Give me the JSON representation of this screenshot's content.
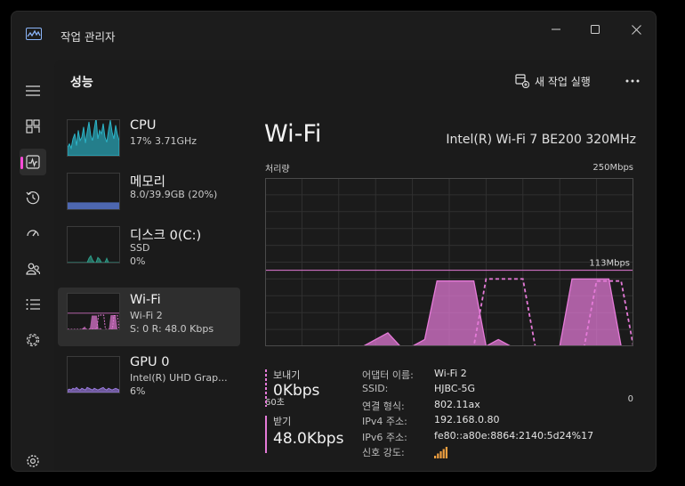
{
  "window": {
    "title": "작업 관리자"
  },
  "nav": {
    "items": [
      {
        "icon": "hamburger-icon"
      },
      {
        "icon": "processes-icon"
      },
      {
        "icon": "performance-icon",
        "active": true
      },
      {
        "icon": "app-history-icon"
      },
      {
        "icon": "startup-apps-icon"
      },
      {
        "icon": "users-icon"
      },
      {
        "icon": "details-icon"
      },
      {
        "icon": "services-icon"
      },
      {
        "icon": "settings-icon"
      }
    ]
  },
  "header": {
    "title": "성능",
    "new_task_label": "새 작업 실행"
  },
  "perf_list": [
    {
      "name": "CPU",
      "sub1": "17% 3.71GHz",
      "sub2": "",
      "color": "#2bb5c9"
    },
    {
      "name": "메모리",
      "sub1": "8.0/39.9GB (20%)",
      "sub2": "",
      "color": "#5a7bd6"
    },
    {
      "name": "디스크 0(C:)",
      "sub1": "SSD",
      "sub2": "0%",
      "color": "#2e9e8a"
    },
    {
      "name": "Wi-Fi",
      "sub1": "Wi-Fi 2",
      "sub2": "S: 0  R: 48.0 Kbps",
      "color": "#e57ad8",
      "selected": true
    },
    {
      "name": "GPU 0",
      "sub1": "Intel(R) UHD Grap...",
      "sub2": "6%",
      "color": "#9b7be0"
    }
  ],
  "detail": {
    "title": "Wi-Fi",
    "adapter": "Intel(R) Wi-Fi 7 BE200 320MHz",
    "y_label": "처리량",
    "y_max": "250Mbps",
    "ref_label": "113Mbps",
    "x_left": "60초",
    "x_right": "0",
    "send": {
      "label": "보내기",
      "value": "0Kbps"
    },
    "receive": {
      "label": "받기",
      "value": "48.0Kbps"
    },
    "info": [
      {
        "key": "어댑터 이름:",
        "value": "Wi-Fi 2"
      },
      {
        "key": "SSID:",
        "value": "HJBC-5G"
      },
      {
        "key": "연결 형식:",
        "value": "802.11ax"
      },
      {
        "key": "IPv4 주소:",
        "value": "192.168.0.80"
      },
      {
        "key": "IPv6 주소:",
        "value": "fe80::a80e:8864:2140:5d24%17"
      },
      {
        "key": "신호 강도:",
        "value": ""
      }
    ],
    "signal_bars": 5
  },
  "chart_data": {
    "type": "area",
    "x": [
      60,
      58,
      56,
      54,
      52,
      50,
      48,
      46,
      44,
      42,
      40,
      38,
      36,
      34,
      32,
      30,
      28,
      26,
      24,
      22,
      20,
      18,
      16,
      14,
      12,
      10,
      8,
      6,
      4,
      2,
      0
    ],
    "xlim": [
      60,
      0
    ],
    "ylim": [
      0,
      250
    ],
    "ylabel": "처리량",
    "y_max_label": "250Mbps",
    "reference_line": {
      "value": 113,
      "label": "113Mbps"
    },
    "series": [
      {
        "name": "받기",
        "style": "filled",
        "color": "#e57ad8",
        "values": [
          0,
          0,
          0,
          0,
          0,
          0,
          0,
          0,
          0,
          10,
          20,
          0,
          0,
          10,
          97,
          97,
          97,
          97,
          0,
          10,
          0,
          0,
          0,
          0,
          0,
          100,
          100,
          100,
          100,
          0,
          0
        ]
      },
      {
        "name": "보내기",
        "style": "dashed",
        "color": "#e57ad8",
        "values": [
          0,
          0,
          0,
          0,
          0,
          0,
          0,
          0,
          0,
          0,
          0,
          0,
          0,
          0,
          0,
          0,
          0,
          0,
          100,
          100,
          100,
          100,
          0,
          0,
          0,
          0,
          0,
          97,
          97,
          97,
          0
        ]
      }
    ]
  }
}
